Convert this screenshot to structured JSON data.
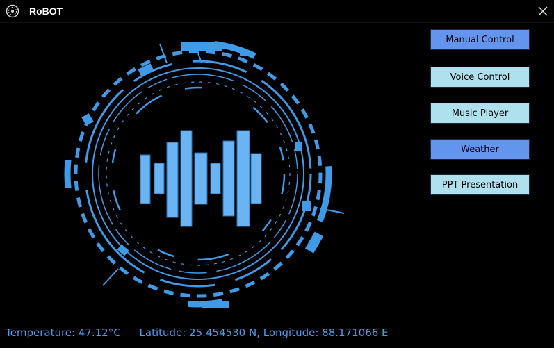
{
  "window": {
    "title": "RoBOT"
  },
  "buttons": [
    {
      "label": "Manual Control",
      "style": "dark"
    },
    {
      "label": "Voice Control",
      "style": "light"
    },
    {
      "label": "Music Player",
      "style": "light"
    },
    {
      "label": "Weather",
      "style": "dark"
    },
    {
      "label": "PPT Presentation",
      "style": "light"
    }
  ],
  "status": {
    "temperature": "Temperature: 47.12°C",
    "location": "Latitude: 25.454530 N, Longitude: 88.171066 E"
  },
  "colors": {
    "accent_blue": "#3f9be8",
    "bar_blue": "#6ab4f3",
    "button_dark": "#6495ed",
    "button_light": "#aee0ed",
    "status_text": "#4a9bf0"
  },
  "icons": {
    "app": "robot-logo-icon",
    "close": "close-icon",
    "visual": "voice-waveform-icon"
  }
}
